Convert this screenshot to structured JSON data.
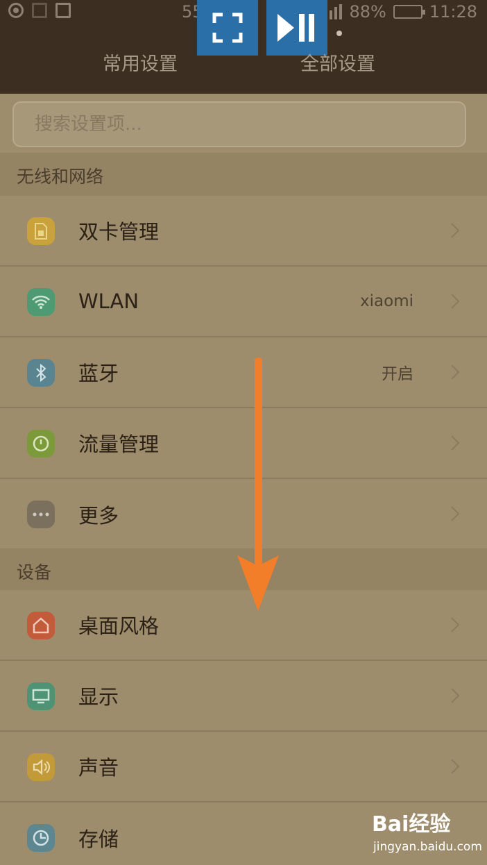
{
  "status_bar": {
    "network_speed": "55",
    "battery_percent": "88%",
    "battery_level": 0.88,
    "time": "11:28"
  },
  "tabs": [
    {
      "label": "常用设置"
    },
    {
      "label": "全部设置"
    }
  ],
  "search": {
    "placeholder": "搜索设置项..."
  },
  "sections": [
    {
      "title": "无线和网络",
      "items": [
        {
          "label": "双卡管理",
          "value": "",
          "icon": "sim-icon",
          "color": "#c9a23c"
        },
        {
          "label": "WLAN",
          "value": "xiaomi",
          "icon": "wifi-icon",
          "color": "#4e9a73"
        },
        {
          "label": "蓝牙",
          "value": "开启",
          "icon": "bluetooth-icon",
          "color": "#5b8491"
        },
        {
          "label": "流量管理",
          "value": "",
          "icon": "data-usage-icon",
          "color": "#7c9a3a"
        },
        {
          "label": "更多",
          "value": "",
          "icon": "more-icon",
          "color": "#7b6f5d"
        }
      ]
    },
    {
      "title": "设备",
      "items": [
        {
          "label": "桌面风格",
          "value": "",
          "icon": "home-icon",
          "color": "#c25b3a"
        },
        {
          "label": "显示",
          "value": "",
          "icon": "display-icon",
          "color": "#4e9474"
        },
        {
          "label": "声音",
          "value": "",
          "icon": "sound-icon",
          "color": "#c39a3a"
        },
        {
          "label": "存储",
          "value": "",
          "icon": "storage-icon",
          "color": "#5d8790"
        }
      ]
    }
  ],
  "overlay": {
    "arrow_color": "#f27e2a",
    "button_color": "#2b6fa9"
  },
  "watermark": {
    "brand": "Bai经验",
    "url": "jingyan.baidu.com"
  }
}
